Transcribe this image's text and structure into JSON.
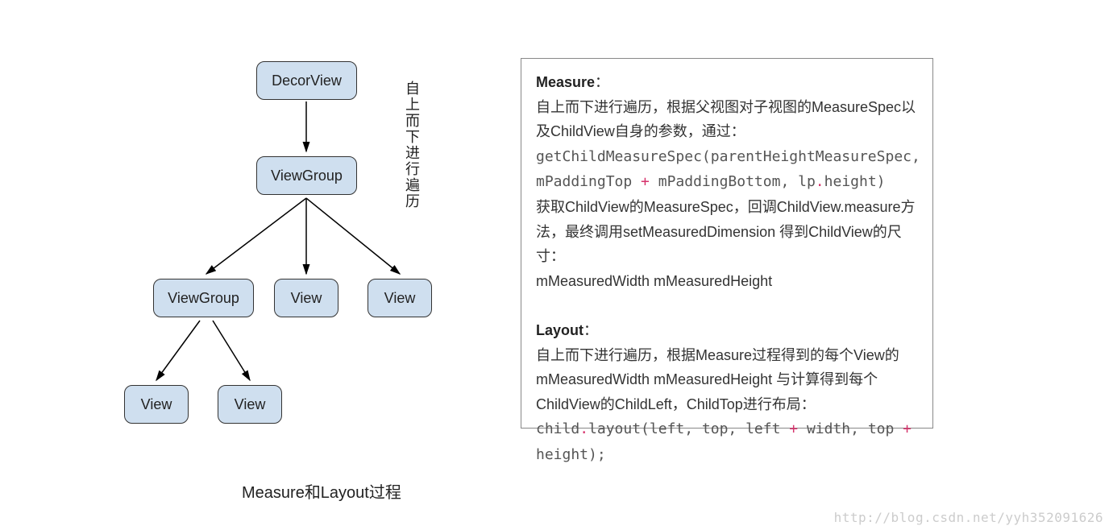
{
  "tree": {
    "decorView": "DecorView",
    "viewGroup1": "ViewGroup",
    "viewGroup2": "ViewGroup",
    "view1": "View",
    "view2": "View",
    "view3": "View",
    "view4": "View"
  },
  "verticalLabel": "自上而下进行遍历",
  "caption": "Measure和Layout过程",
  "panel": {
    "measureTitle": "Measure",
    "measureIntro": "自上而下进行遍历，根据父视图对子视图的MeasureSpec以及ChildView自身的参数，通过：",
    "code1a": "getChildMeasureSpec(parentHeightMeasureSpec,",
    "code1b_prefix": "mPaddingTop ",
    "code1b_op": "+",
    "code1b_mid": " mPaddingBottom, lp",
    "code1b_dot": ".",
    "code1b_suffix": "height)",
    "measureAfter": "获取ChildView的MeasureSpec，回调ChildView.measure方法，最终调用setMeasuredDimension 得到ChildView的尺寸：",
    "measureResult": "mMeasuredWidth  mMeasuredHeight",
    "layoutTitle": "Layout",
    "layoutIntro": "自上而下进行遍历，根据Measure过程得到的每个View的mMeasuredWidth  mMeasuredHeight 与计算得到每个ChildView的ChildLeft，ChildTop进行布局：",
    "code2_prefix": "child",
    "code2_d1": ".",
    "code2_a": "layout(left, top, left ",
    "code2_op1": "+",
    "code2_b": " width, top ",
    "code2_op2": "+",
    "code2_c": " height);"
  },
  "watermark": "http://blog.csdn.net/yyh352091626"
}
